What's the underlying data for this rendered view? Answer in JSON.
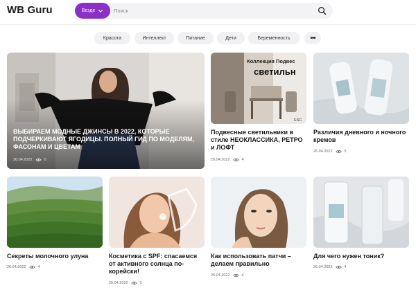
{
  "header": {
    "logo": "WB Guru",
    "scope_label": "Везде",
    "search_placeholder": "Поиск"
  },
  "categories": [
    "Красота",
    "Интеллект",
    "Питание",
    "Дети",
    "Беременность"
  ],
  "more_label": "•••",
  "featured": {
    "title": "ВЫБИРАЕМ МОДНЫЕ ДЖИНСЫ В 2022, КОТОРЫЕ ПОДЧЕРКИВАЮТ ЯГОДИЦЫ. ПОЛНЫЙ ГИД ПО МОДЕЛЯМ, ФАСОНАМ И ЦВЕТАМ",
    "date": "26.04.2022",
    "views": "0"
  },
  "articles_top": [
    {
      "title": "Подвесные светильники в стиле НЕОКЛАССИКА, РЕТРО и ЛОФТ",
      "date": "26.04.2022",
      "views": "4",
      "image_text_line1": "Коллекция Подвес",
      "image_text_line2": "светильн",
      "image_text_line3": "ESC"
    },
    {
      "title": "Различия дневного и ночного кремов",
      "date": "26.04.2022",
      "views": "5"
    }
  ],
  "articles_bottom": [
    {
      "title": "Секреты молочного улуна",
      "date": "26.04.2022",
      "views": "4"
    },
    {
      "title": "Косметика с SPF: спасаемся от активного солнца по-корейски!",
      "date": "26.04.2022",
      "views": "0"
    },
    {
      "title": "Как использовать патчи – делаем правильно",
      "date": "26.04.2022",
      "views": "4"
    },
    {
      "title": "Для чего нужен тоник?",
      "date": "26.04.2022",
      "views": "4"
    }
  ],
  "colors": {
    "accent": "#8b2fc9",
    "chip_bg": "#f1f1f3",
    "search_bg": "#f3f3f5"
  },
  "icons": {
    "scope_chevron": "chevron-down-icon",
    "search": "search-icon",
    "views": "eye-icon"
  }
}
